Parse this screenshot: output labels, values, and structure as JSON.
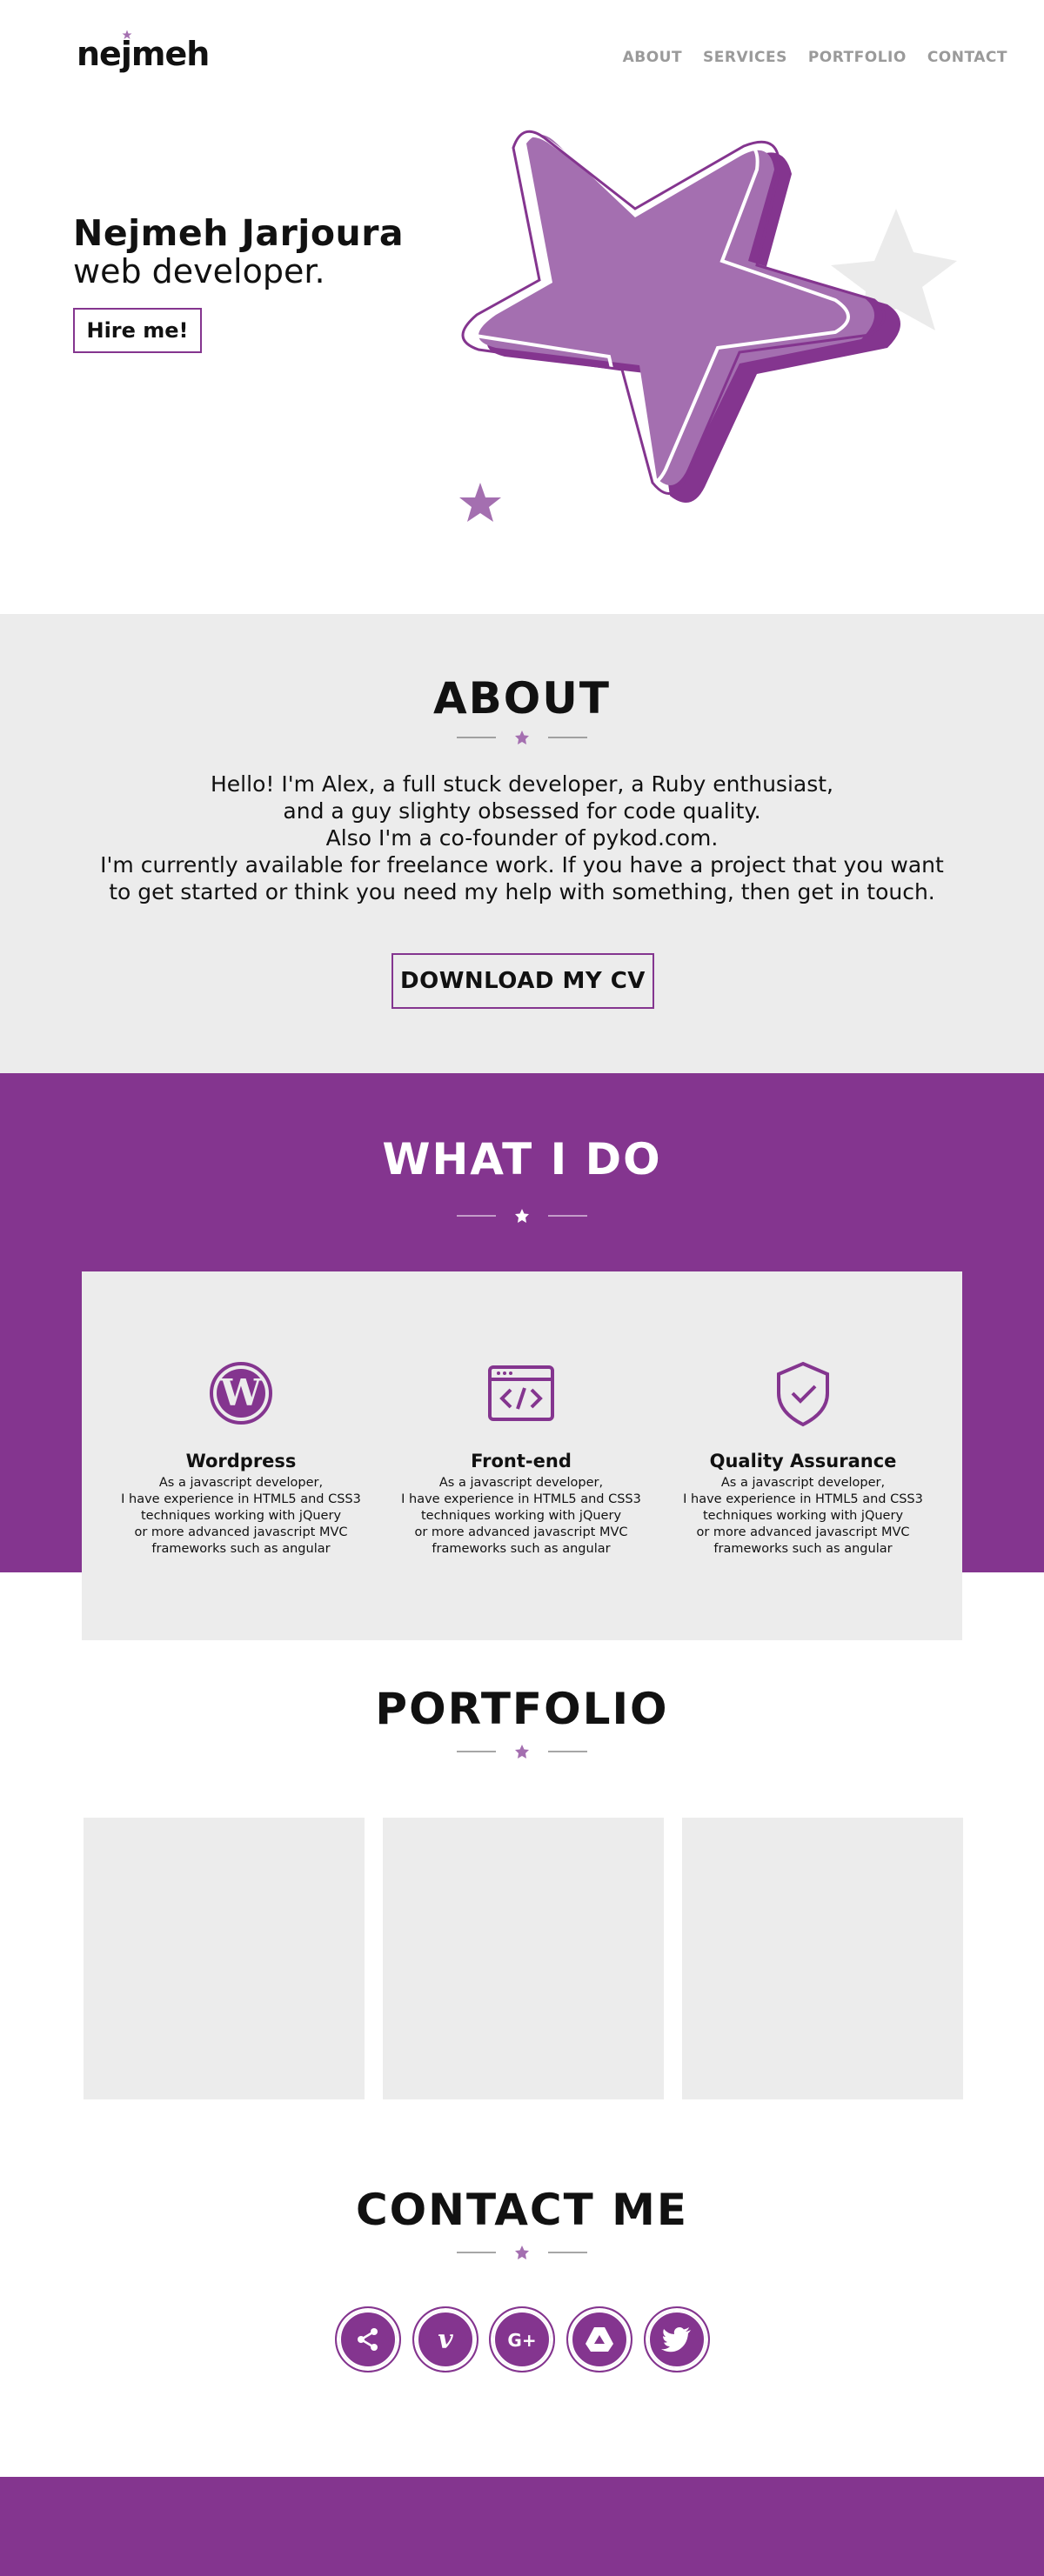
{
  "header": {
    "logo": "nejmeh",
    "nav": [
      "ABOUT",
      "SERVICES",
      "PORTFOLIO",
      "CONTACT"
    ]
  },
  "hero": {
    "name": "Nejmeh Jarjoura",
    "role": "web developer.",
    "cta": "Hire me!"
  },
  "about": {
    "title": "ABOUT",
    "lines": [
      "Hello! I'm Alex, a full stuck developer, a Ruby enthusiast,",
      "and a guy slighty obsessed for code quality.",
      "Also I'm a co-founder of pykod.com.",
      "I'm currently available for freelance work. If you have a project that you want",
      "to get started or think you need my help with something, then get in touch."
    ],
    "cv_button": "DOWNLOAD MY CV"
  },
  "services": {
    "title": "WHAT I DO",
    "items": [
      {
        "icon": "wordpress-icon",
        "title": "Wordpress",
        "desc": [
          "As a javascript developer,",
          "I have experience in HTML5 and CSS3",
          "techniques working with jQuery",
          "or more advanced javascript MVC",
          "frameworks such as angular"
        ]
      },
      {
        "icon": "code-window-icon",
        "title": "Front-end",
        "desc": [
          "As a javascript developer,",
          "I have experience in HTML5 and CSS3",
          "techniques working with jQuery",
          "or more advanced javascript MVC",
          "frameworks such as angular"
        ]
      },
      {
        "icon": "shield-check-icon",
        "title": "Quality Assurance",
        "desc": [
          "As a javascript developer,",
          "I have experience in HTML5 and CSS3",
          "techniques working with jQuery",
          "or more advanced javascript MVC",
          "frameworks such as angular"
        ]
      }
    ]
  },
  "portfolio": {
    "title": "PORTFOLIO"
  },
  "contact": {
    "title": "CONTACT ME",
    "socials": [
      "share-icon",
      "vimeo-icon",
      "google-plus-icon",
      "google-drive-icon",
      "twitter-icon"
    ]
  },
  "colors": {
    "accent": "#84358f",
    "light_accent": "#a46fb0",
    "section_bg": "#ececec"
  }
}
